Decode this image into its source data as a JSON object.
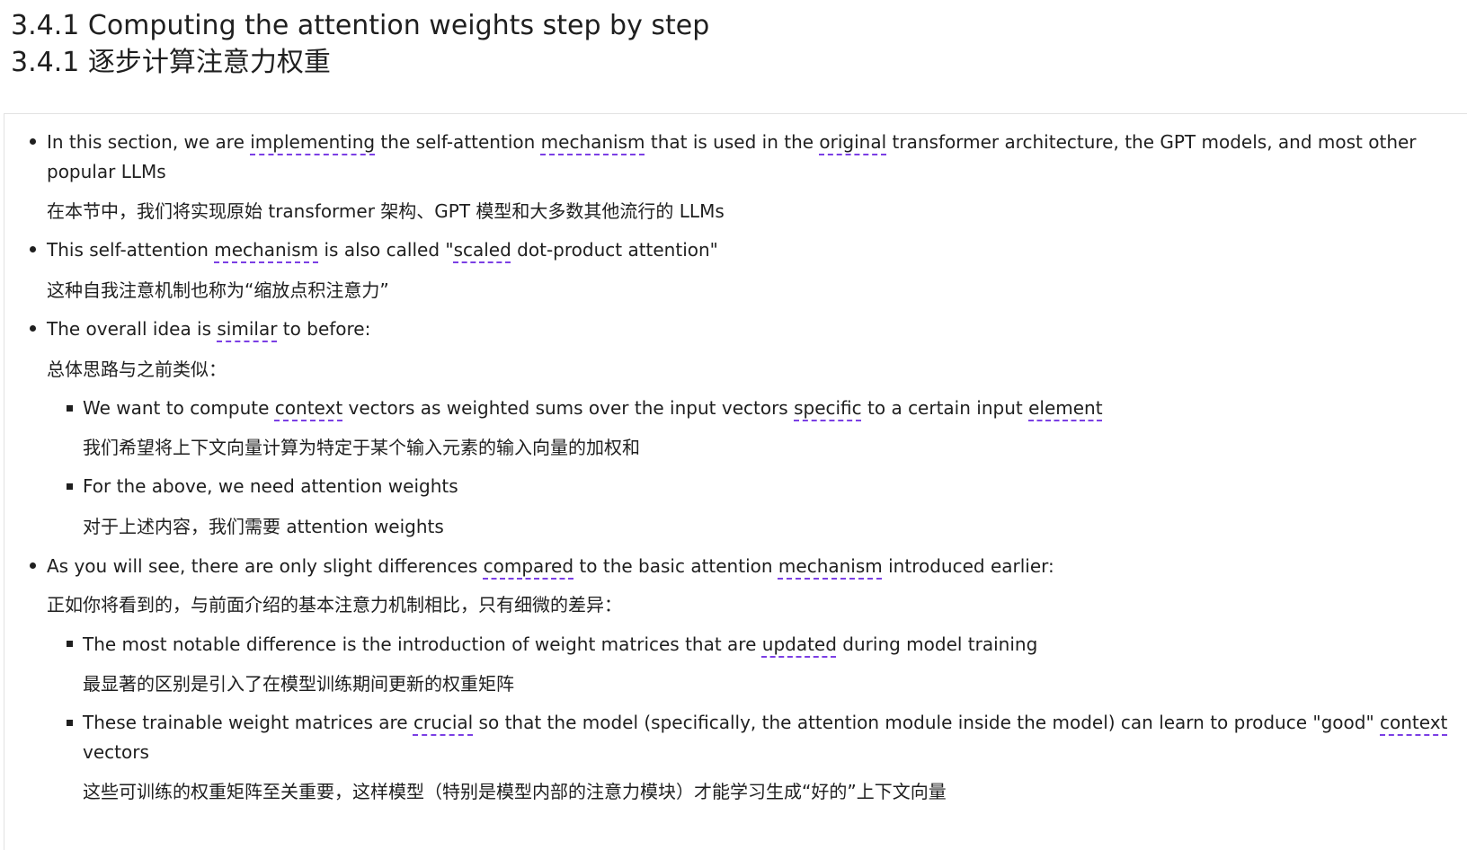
{
  "heading": {
    "en": "3.4.1 Computing the attention weights step by step",
    "zh": "3.4.1 逐步计算注意力权重"
  },
  "bullets": [
    {
      "en_parts": [
        "In this section, we are ",
        "implementing",
        " the self-attention ",
        "mechanism",
        " that is used in the ",
        "original",
        " transformer architecture, the GPT models, and most other"
      ],
      "en_line2": "popular LLMs",
      "zh": "在本节中，我们将实现原始 transformer 架构、GPT 模型和大多数其他流行的 LLMs"
    },
    {
      "en_parts": [
        "This self-attention ",
        "mechanism",
        " is also called \"",
        "scaled",
        " dot-product attention\""
      ],
      "zh": "这种自我注意机制也称为“缩放点积注意力”"
    },
    {
      "en_parts": [
        "The overall idea is ",
        "similar",
        " to before:"
      ],
      "zh": "总体思路与之前类似："
    },
    {
      "en_parts": [
        "As you will see, there are only slight differences ",
        "compared",
        " to the basic attention ",
        "mechanism",
        " introduced earlier:"
      ],
      "zh": "正如你将看到的，与前面介绍的基本注意力机制相比，只有细微的差异："
    }
  ],
  "sub_a": [
    {
      "en_parts": [
        "We want to compute ",
        "context",
        " vectors as weighted sums over the input vectors ",
        "specific",
        " to a certain input ",
        "element"
      ],
      "zh": "我们希望将上下文向量计算为特定于某个输入元素的输入向量的加权和"
    },
    {
      "en_parts": [
        "For the above, we need attention weights"
      ],
      "zh": "对于上述内容，我们需要 attention weights"
    }
  ],
  "sub_b": [
    {
      "en_parts": [
        "The most notable difference is the introduction of weight matrices that are ",
        "updated",
        " during model training"
      ],
      "zh": "最显著的区别是引入了在模型训练期间更新的权重矩阵"
    },
    {
      "en_parts": [
        "These trainable weight matrices are ",
        "crucial",
        " so that the model (specifically, the attention module inside the model) can learn to produce \"good\" ",
        "context"
      ],
      "en_line2": "vectors",
      "zh": "这些可训练的权重矩阵至关重要，这样模型（特别是模型内部的注意力模块）才能学习生成“好的”上下文向量"
    }
  ],
  "colors": {
    "text": "#1f1f1f",
    "spellcheck_underline": "#7b3fe4",
    "cell_border": "#e2e2e2"
  }
}
